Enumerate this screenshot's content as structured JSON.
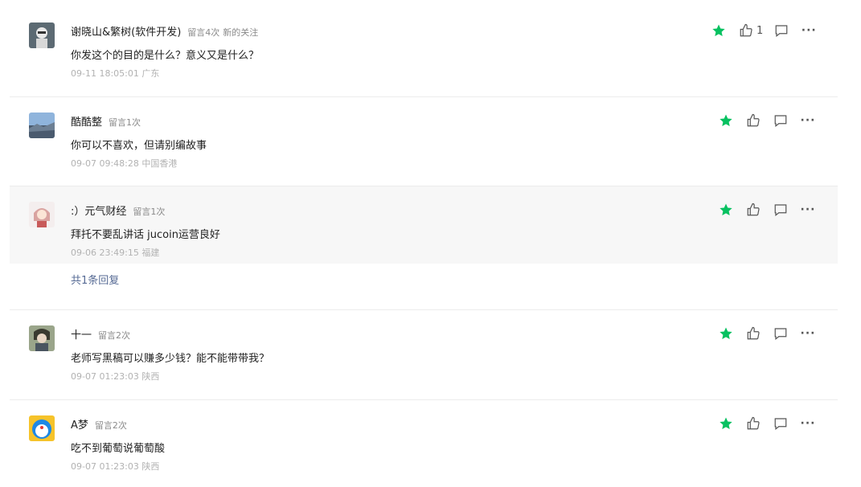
{
  "comments": [
    {
      "nickname": "谢晓山&繁树(软件开发)",
      "message_count": "留言4次",
      "tag": "新的关注",
      "content": "你发这个的目的是什么？意义又是什么？",
      "time": "09-11 18:05:01 广东",
      "likes": "1"
    },
    {
      "nickname": "酷酷整",
      "message_count": "留言1次",
      "content": "你可以不喜欢，但请别编故事",
      "time": "09-07 09:48:28 中国香港"
    },
    {
      "nickname": ":）元气财经",
      "message_count": "留言1次",
      "content": "拜托不要乱讲话 jucoin运营良好",
      "time": "09-06 23:49:15 福建"
    },
    {
      "nickname": "十一",
      "message_count": "留言2次",
      "content": "老师写黑稿可以赚多少钱？能不能带带我？",
      "time": "09-07 01:23:03 陕西"
    },
    {
      "nickname": "A梦",
      "message_count": "留言2次",
      "content": "吃不到葡萄说葡萄酸",
      "time": "09-07 01:23:03 陕西"
    }
  ],
  "reply_link": "共1条回复",
  "icons": {
    "star": "star-icon",
    "like": "thumbs-up-icon",
    "reply": "comment-icon",
    "more": "more-icon"
  },
  "colors": {
    "accent": "#07c160",
    "link": "#576b95"
  }
}
